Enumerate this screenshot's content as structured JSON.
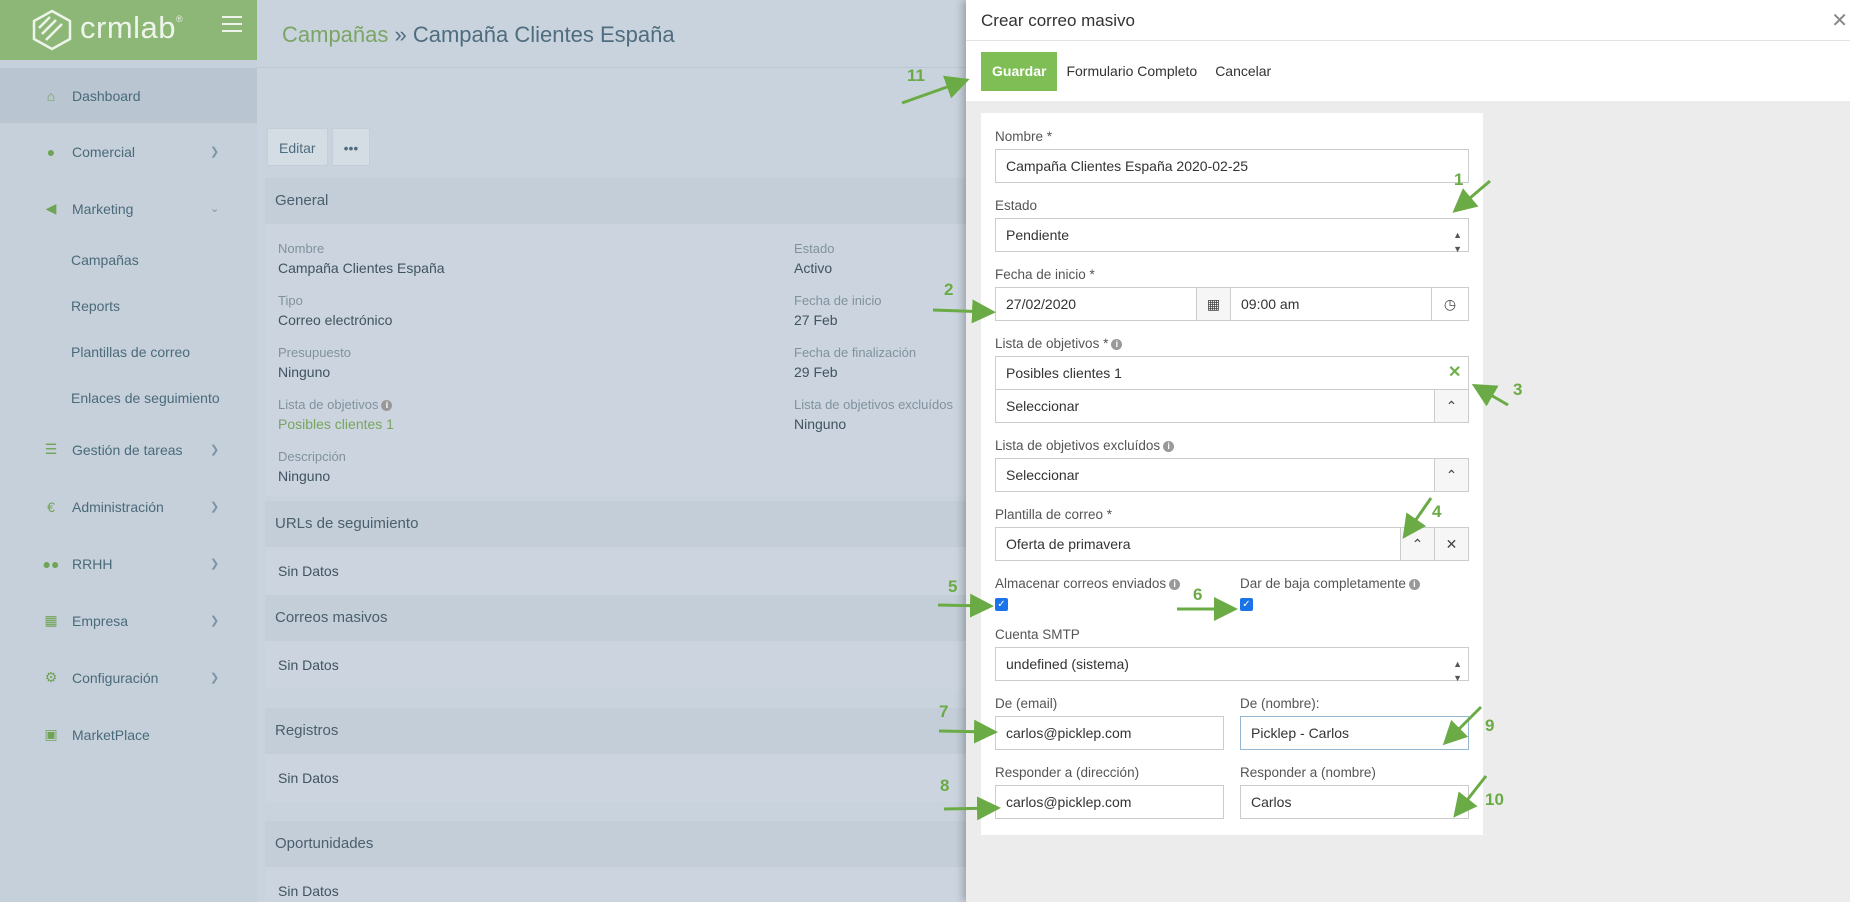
{
  "brand": {
    "name": "crmlab",
    "mark": "®"
  },
  "sidebar": {
    "items": [
      {
        "label": "Dashboard",
        "icon": "home-icon"
      },
      {
        "label": "Comercial",
        "icon": "user-icon"
      },
      {
        "label": "Marketing",
        "icon": "megaphone-icon"
      },
      {
        "label": "Gestión de tareas",
        "icon": "list-icon"
      },
      {
        "label": "Administración",
        "icon": "euro-icon"
      },
      {
        "label": "RRHH",
        "icon": "users-icon"
      },
      {
        "label": "Empresa",
        "icon": "building-icon"
      },
      {
        "label": "Configuración",
        "icon": "gear-icon"
      },
      {
        "label": "MarketPlace",
        "icon": "bag-icon"
      }
    ],
    "marketing_sub": [
      "Campañas",
      "Reports",
      "Plantillas de correo",
      "Enlaces de seguimiento"
    ]
  },
  "main": {
    "breadcrumb_parent": "Campañas",
    "breadcrumb_sep": " » ",
    "title": "Campaña Clientes España",
    "edit_label": "Editar",
    "more_label": "•••",
    "general_title": "General",
    "fields": {
      "nombre_label": "Nombre",
      "nombre": "Campaña Clientes España",
      "estado_label": "Estado",
      "estado": "Activo",
      "tipo_label": "Tipo",
      "tipo": "Correo electrónico",
      "fecha_inicio_label": "Fecha de inicio",
      "fecha_inicio": "27 Feb",
      "presupuesto_label": "Presupuesto",
      "presupuesto": "Ninguno",
      "fecha_fin_label": "Fecha de finalización",
      "fecha_fin": "29 Feb",
      "lista_label": "Lista de objetivos",
      "lista": "Posibles clientes 1",
      "lista_excl_label": "Lista de objetivos excluídos",
      "lista_excl": "Ninguno",
      "descripcion_label": "Descripción",
      "descripcion": "Ninguno"
    },
    "sections": [
      {
        "title": "URLs de seguimiento",
        "text": "Sin Datos"
      },
      {
        "title": "Correos masivos",
        "text": "Sin Datos"
      },
      {
        "title": "Registros",
        "text": "Sin Datos"
      },
      {
        "title": "Oportunidades",
        "text": "Sin Datos"
      }
    ]
  },
  "drawer": {
    "title": "Crear correo masivo",
    "close": "✕",
    "save": "Guardar",
    "full_form": "Formulario Completo",
    "cancel": "Cancelar",
    "form": {
      "nombre_label": "Nombre *",
      "nombre_value": "Campaña Clientes España 2020-02-25",
      "estado_label": "Estado",
      "estado_value": "Pendiente",
      "fecha_label": "Fecha de inicio *",
      "fecha_value": "27/02/2020",
      "hora_value": "09:00 am",
      "lista_label": "Lista de objetivos *",
      "lista_value": "Posibles clientes 1",
      "seleccionar": "Seleccionar",
      "lista_excl_label": "Lista de objetivos excluídos",
      "plantilla_label": "Plantilla de correo *",
      "plantilla_value": "Oferta de primavera",
      "almacenar_label": "Almacenar correos enviados",
      "baja_label": "Dar de baja completamente",
      "smtp_label": "Cuenta SMTP",
      "smtp_value": "undefined (sistema)",
      "de_email_label": "De (email)",
      "de_email_value": "carlos@picklep.com",
      "de_nombre_label": "De (nombre):",
      "de_nombre_value": "Picklep - Carlos",
      "resp_dir_label": "Responder a (dirección)",
      "resp_dir_value": "carlos@picklep.com",
      "resp_nombre_label": "Responder a (nombre)",
      "resp_nombre_value": "Carlos"
    }
  },
  "annotations": [
    "1",
    "2",
    "3",
    "4",
    "5",
    "6",
    "7",
    "8",
    "9",
    "10",
    "11"
  ],
  "colors": {
    "accent": "#7fbe55",
    "arrow": "#6bab45"
  }
}
